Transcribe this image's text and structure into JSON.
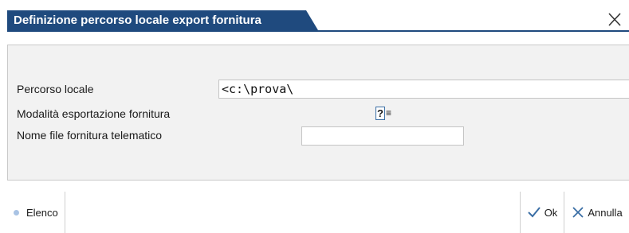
{
  "window": {
    "title": "Definizione percorso locale export fornitura",
    "close_icon": "close-icon",
    "accent_color": "#1f4a7e"
  },
  "form": {
    "path_label": "Percorso locale",
    "path_value": "<c:\\prova\\",
    "mode_label": "Modalità esportazione fornitura",
    "mode_value": "?",
    "mode_menu_icon": "≡",
    "filename_label": "Nome file fornitura telematico",
    "filename_value": ""
  },
  "footer": {
    "elenco_label": "Elenco",
    "ok_label": "Ok",
    "annulla_label": "Annulla"
  }
}
